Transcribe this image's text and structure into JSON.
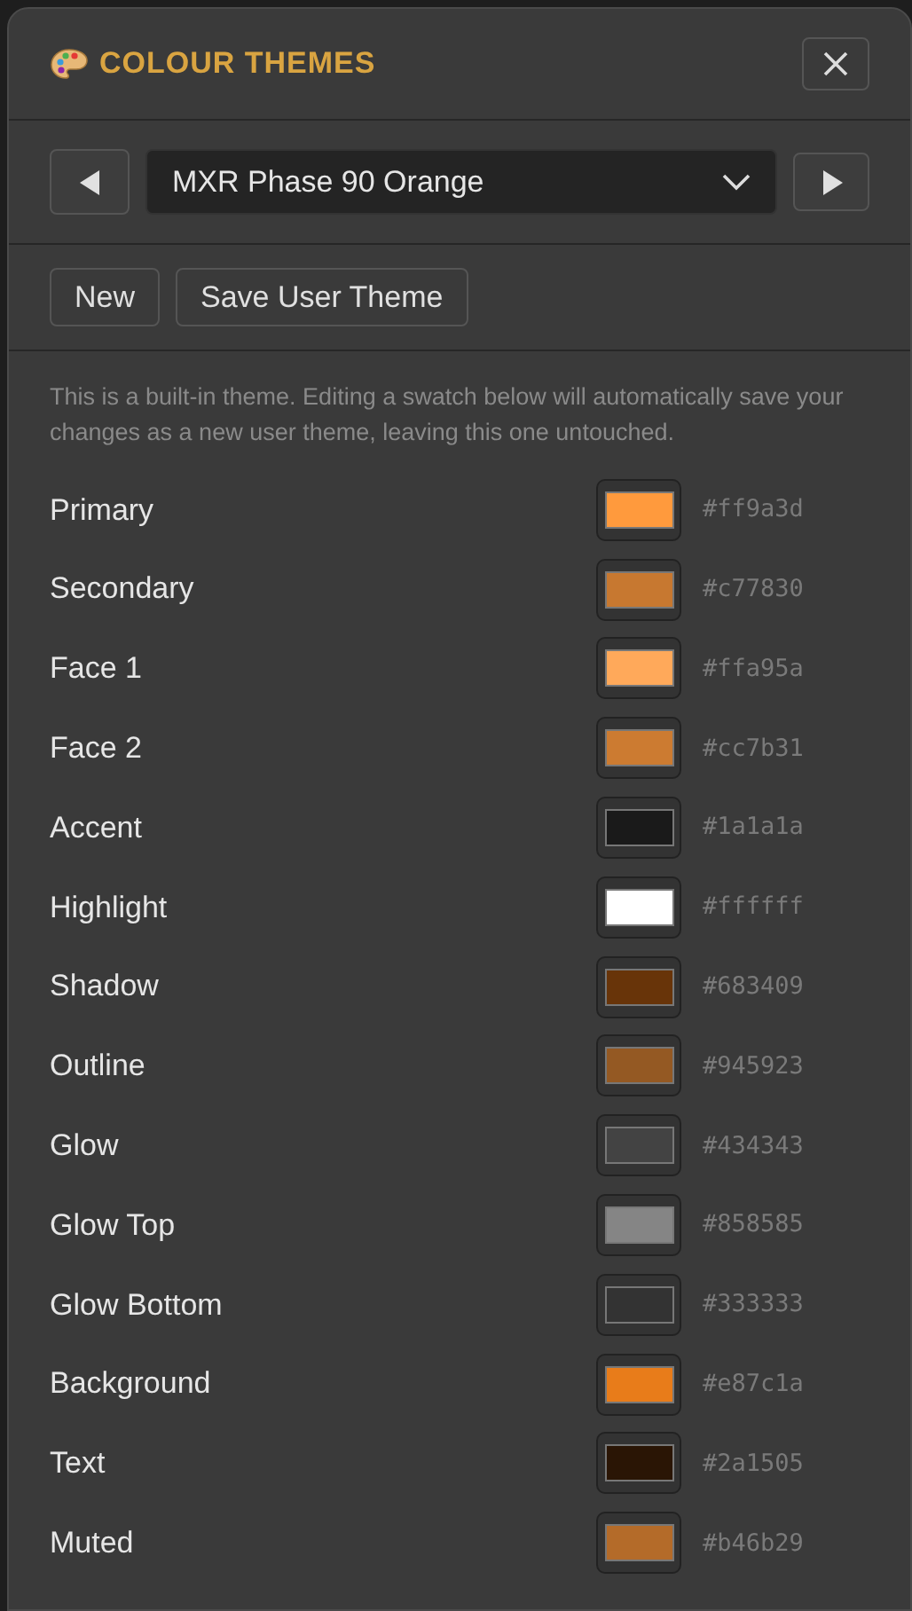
{
  "panel": {
    "title": "COLOUR THEMES"
  },
  "theme_select": {
    "value": "MXR Phase 90 Orange"
  },
  "buttons": [
    "New",
    "Save User Theme"
  ],
  "note": "This is a built-in theme. Editing a swatch below will automatically save your changes as a new user theme, leaving this one untouched.",
  "swatches": [
    {
      "label": "Primary",
      "color": "#ff9a3d",
      "hex": "#ff9a3d"
    },
    {
      "label": "Secondary",
      "color": "#c77830",
      "hex": "#c77830"
    },
    {
      "label": "Face 1",
      "color": "#ffa95a",
      "hex": "#ffa95a"
    },
    {
      "label": "Face 2",
      "color": "#cc7b31",
      "hex": "#cc7b31"
    },
    {
      "label": "Accent",
      "color": "#1a1a1a",
      "hex": "#1a1a1a"
    },
    {
      "label": "Highlight",
      "color": "#ffffff",
      "hex": "#ffffff"
    },
    {
      "label": "Shadow",
      "color": "#683409",
      "hex": "#683409"
    },
    {
      "label": "Outline",
      "color": "#945923",
      "hex": "#945923"
    },
    {
      "label": "Glow",
      "color": "#434343",
      "hex": "#434343"
    },
    {
      "label": "Glow Top",
      "color": "#858585",
      "hex": "#858585"
    },
    {
      "label": "Glow Bottom",
      "color": "#333333",
      "hex": "#333333"
    },
    {
      "label": "Background",
      "color": "#e87c1a",
      "hex": "#e87c1a"
    },
    {
      "label": "Text",
      "color": "#2a1505",
      "hex": "#2a1505"
    },
    {
      "label": "Muted",
      "color": "#b46b29",
      "hex": "#b46b29"
    }
  ]
}
